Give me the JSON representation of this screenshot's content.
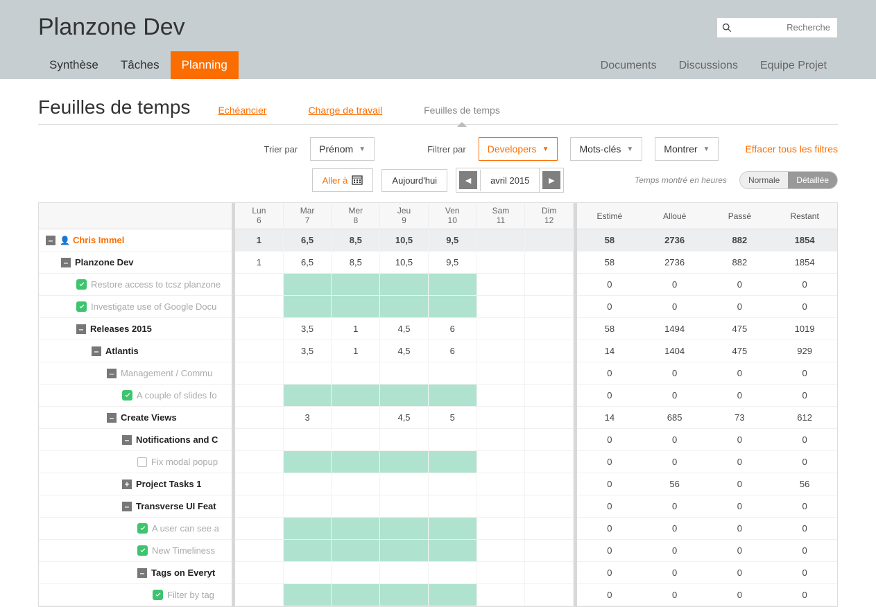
{
  "app": {
    "title": "Planzone Dev"
  },
  "search": {
    "placeholder": "Recherche"
  },
  "nav": {
    "left": [
      "Synthèse",
      "Tâches",
      "Planning"
    ],
    "active": "Planning",
    "right": [
      "Documents",
      "Discussions",
      "Equipe Projet"
    ]
  },
  "page": {
    "title": "Feuilles de temps",
    "subtabs": [
      "Echéancier",
      "Charge de travail",
      "Feuilles de temps"
    ],
    "active_subtab": "Feuilles de temps"
  },
  "controls": {
    "sort_label": "Trier par",
    "sort_value": "Prénom",
    "filter_label": "Filtrer par",
    "filter_value": "Developers",
    "keywords": "Mots-clés",
    "show": "Montrer",
    "clear": "Effacer tous les filtres"
  },
  "toolbar": {
    "goto": "Aller à",
    "today": "Aujourd'hui",
    "period": "avril 2015",
    "hint": "Temps montré en heures",
    "view_normal": "Normale",
    "view_detail": "Détaillée"
  },
  "days": [
    {
      "name": "Lun",
      "num": "6"
    },
    {
      "name": "Mar",
      "num": "7"
    },
    {
      "name": "Mer",
      "num": "8"
    },
    {
      "name": "Jeu",
      "num": "9"
    },
    {
      "name": "Ven",
      "num": "10"
    },
    {
      "name": "Sam",
      "num": "11"
    },
    {
      "name": "Dim",
      "num": "12"
    }
  ],
  "summary_headers": [
    "Estimé",
    "Alloué",
    "Passé",
    "Restant"
  ],
  "rows": [
    {
      "indent": 0,
      "icon": "minus",
      "user": true,
      "label": "Chris Immel",
      "bold": true,
      "orange": true,
      "days": [
        "1",
        "6,5",
        "8,5",
        "10,5",
        "9,5",
        "",
        ""
      ],
      "sum": [
        "58",
        "2736",
        "882",
        "1854"
      ],
      "shade": []
    },
    {
      "indent": 1,
      "icon": "minus",
      "label": "Planzone Dev",
      "bold": true,
      "days": [
        "1",
        "6,5",
        "8,5",
        "10,5",
        "9,5",
        "",
        ""
      ],
      "sum": [
        "58",
        "2736",
        "882",
        "1854"
      ],
      "shade": []
    },
    {
      "indent": 2,
      "icon": "check",
      "label": "Restore access to tcsz planzone",
      "grey": true,
      "days": [
        "",
        "",
        "",
        "",
        "",
        "",
        ""
      ],
      "sum": [
        "0",
        "0",
        "0",
        "0"
      ],
      "shade": [
        1,
        2,
        3,
        4
      ]
    },
    {
      "indent": 2,
      "icon": "check",
      "label": "Investigate use of Google Docu",
      "grey": true,
      "days": [
        "",
        "",
        "",
        "",
        "",
        "",
        ""
      ],
      "sum": [
        "0",
        "0",
        "0",
        "0"
      ],
      "shade": [
        1,
        2,
        3,
        4
      ]
    },
    {
      "indent": 2,
      "icon": "minus",
      "label": "Releases 2015",
      "bold": true,
      "days": [
        "",
        "3,5",
        "1",
        "4,5",
        "6",
        "",
        ""
      ],
      "sum": [
        "58",
        "1494",
        "475",
        "1019"
      ],
      "shade": []
    },
    {
      "indent": 3,
      "icon": "minus",
      "label": "Atlantis",
      "bold": true,
      "days": [
        "",
        "3,5",
        "1",
        "4,5",
        "6",
        "",
        ""
      ],
      "sum": [
        "14",
        "1404",
        "475",
        "929"
      ],
      "shade": []
    },
    {
      "indent": 4,
      "icon": "minus",
      "label": "Management / Commu",
      "grey": true,
      "days": [
        "",
        "",
        "",
        "",
        "",
        "",
        ""
      ],
      "sum": [
        "0",
        "0",
        "0",
        "0"
      ],
      "shade": []
    },
    {
      "indent": 5,
      "icon": "check",
      "label": "A couple of slides fo",
      "grey": true,
      "days": [
        "",
        "",
        "",
        "",
        "",
        "",
        ""
      ],
      "sum": [
        "0",
        "0",
        "0",
        "0"
      ],
      "shade": [
        1,
        2,
        3,
        4
      ]
    },
    {
      "indent": 4,
      "icon": "minus",
      "label": "Create Views",
      "bold": true,
      "days": [
        "",
        "3",
        "",
        "4,5",
        "5",
        "",
        ""
      ],
      "sum": [
        "14",
        "685",
        "73",
        "612"
      ],
      "shade": []
    },
    {
      "indent": 5,
      "icon": "minus",
      "label": "Notifications and C",
      "bold": true,
      "days": [
        "",
        "",
        "",
        "",
        "",
        "",
        ""
      ],
      "sum": [
        "0",
        "0",
        "0",
        "0"
      ],
      "shade": []
    },
    {
      "indent": 6,
      "icon": "empty",
      "label": "Fix modal popup",
      "grey": true,
      "days": [
        "",
        "",
        "",
        "",
        "",
        "",
        ""
      ],
      "sum": [
        "0",
        "0",
        "0",
        "0"
      ],
      "shade": [
        1,
        2,
        3,
        4
      ]
    },
    {
      "indent": 5,
      "icon": "plus",
      "label": "Project Tasks 1",
      "bold": true,
      "days": [
        "",
        "",
        "",
        "",
        "",
        "",
        ""
      ],
      "sum": [
        "0",
        "56",
        "0",
        "56"
      ],
      "shade": []
    },
    {
      "indent": 5,
      "icon": "minus",
      "label": "Transverse UI Feat",
      "bold": true,
      "days": [
        "",
        "",
        "",
        "",
        "",
        "",
        ""
      ],
      "sum": [
        "0",
        "0",
        "0",
        "0"
      ],
      "shade": []
    },
    {
      "indent": 6,
      "icon": "check",
      "label": "A user can see a",
      "grey": true,
      "days": [
        "",
        "",
        "",
        "",
        "",
        "",
        ""
      ],
      "sum": [
        "0",
        "0",
        "0",
        "0"
      ],
      "shade": [
        1,
        2,
        3,
        4
      ]
    },
    {
      "indent": 6,
      "icon": "check",
      "label": "New Timeliness",
      "grey": true,
      "days": [
        "",
        "",
        "",
        "",
        "",
        "",
        ""
      ],
      "sum": [
        "0",
        "0",
        "0",
        "0"
      ],
      "shade": [
        1,
        2,
        3,
        4
      ]
    },
    {
      "indent": 6,
      "icon": "minus",
      "label": "Tags on Everyt",
      "bold": true,
      "days": [
        "",
        "",
        "",
        "",
        "",
        "",
        ""
      ],
      "sum": [
        "0",
        "0",
        "0",
        "0"
      ],
      "shade": []
    },
    {
      "indent": 7,
      "icon": "check",
      "label": "Filter by tag",
      "grey": true,
      "days": [
        "",
        "",
        "",
        "",
        "",
        "",
        ""
      ],
      "sum": [
        "0",
        "0",
        "0",
        "0"
      ],
      "shade": [
        1,
        2,
        3,
        4
      ]
    }
  ]
}
